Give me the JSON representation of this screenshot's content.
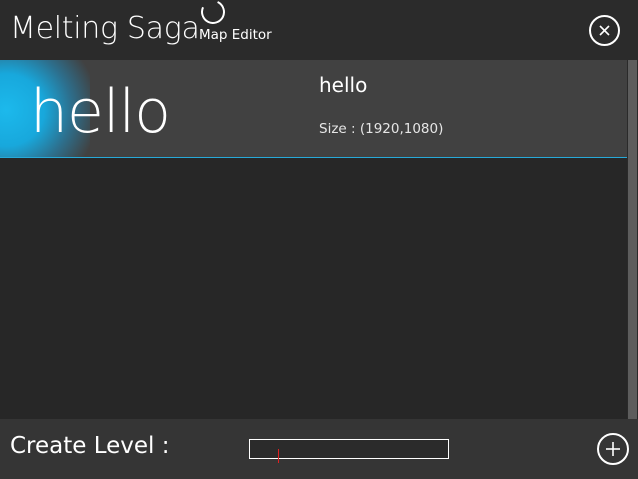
{
  "header": {
    "app_title": "Melting Saga",
    "subtitle": "Map Editor",
    "close_icon": "close-icon"
  },
  "levels": [
    {
      "thumbnail_text": "hello",
      "name": "hello",
      "size_text": "Size : (1920,1080)"
    }
  ],
  "footer": {
    "create_label": "Create Level :",
    "input_value": "",
    "add_icon": "plus-icon"
  },
  "colors": {
    "accent": "#27a9d8",
    "background": "#272727",
    "item_background": "#414141",
    "footer_background": "#353535"
  }
}
